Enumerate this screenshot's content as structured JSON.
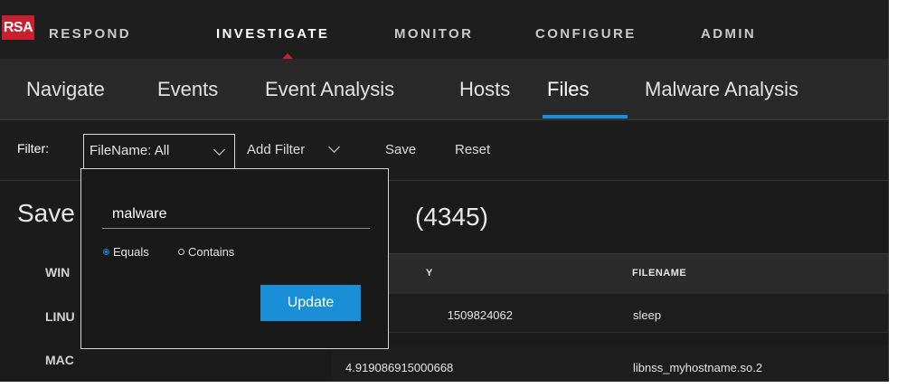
{
  "topnav": {
    "logo": "RSA",
    "items": [
      {
        "label": "RESPOND",
        "active": false
      },
      {
        "label": "INVESTIGATE",
        "active": true
      },
      {
        "label": "MONITOR",
        "active": false
      },
      {
        "label": "CONFIGURE",
        "active": false
      },
      {
        "label": "ADMIN",
        "active": false
      }
    ]
  },
  "subnav": {
    "tabs": [
      {
        "label": "Navigate",
        "active": false
      },
      {
        "label": "Events",
        "active": false
      },
      {
        "label": "Event Analysis",
        "active": false
      },
      {
        "label": "Hosts",
        "active": false
      },
      {
        "label": "Files",
        "active": true
      },
      {
        "label": "Malware Analysis",
        "active": false
      }
    ]
  },
  "filterbar": {
    "label": "Filter:",
    "filename_filter": "FileName: All",
    "add_filter": "Add Filter",
    "save": "Save",
    "reset": "Reset"
  },
  "saved_filters": {
    "title": "Save",
    "items": [
      "WIN",
      "LINU",
      "MAC"
    ]
  },
  "files": {
    "count": "(4345)",
    "columns": [
      "Y",
      "FILENAME"
    ],
    "rows": [
      {
        "value": "1509824062",
        "filename": "sleep"
      },
      {
        "value": "4.919086915000668",
        "filename": "libnss_myhostname.so.2"
      }
    ]
  },
  "popup": {
    "input_value": "malware",
    "options": [
      {
        "label": "Equals",
        "selected": true
      },
      {
        "label": "Contains",
        "selected": false
      }
    ],
    "update_label": "Update"
  },
  "colors": {
    "accent": "#1a8fd8",
    "brand": "#c8202f",
    "background": "#1b1b1b"
  }
}
